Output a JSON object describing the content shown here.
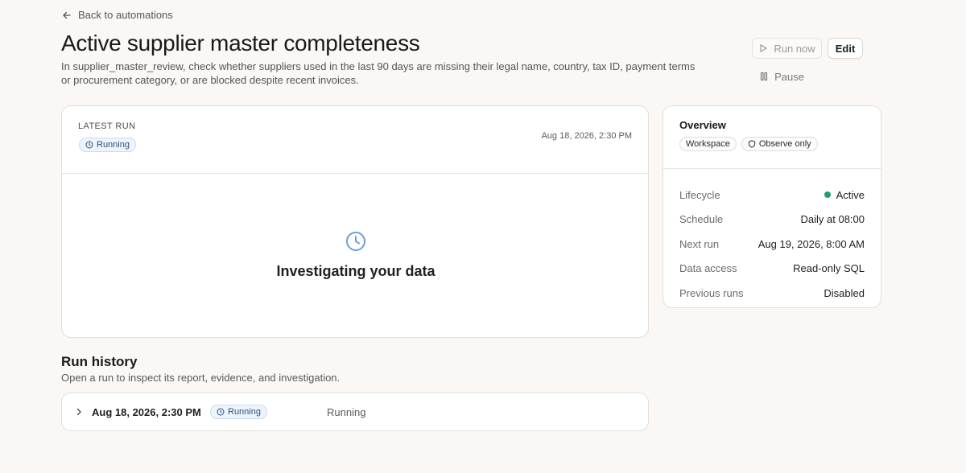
{
  "nav": {
    "back_label": "Back to automations"
  },
  "header": {
    "title": "Active supplier master completeness",
    "description": "In supplier_master_review, check whether suppliers used in the last 90 days are missing their legal name, country, tax ID, payment terms or procurement category, or are blocked despite recent invoices."
  },
  "actions": {
    "run_now_label": "Run now",
    "edit_label": "Edit",
    "pause_label": "Pause"
  },
  "latest_run": {
    "eyebrow": "LATEST RUN",
    "status": "Running",
    "timestamp": "Aug 18, 2026, 2:30 PM",
    "empty_title": "Investigating your data"
  },
  "overview": {
    "title": "Overview",
    "chips": [
      "Workspace",
      "Observe only"
    ],
    "rows": [
      {
        "label": "Lifecycle",
        "value": "Active"
      },
      {
        "label": "Schedule",
        "value": "Daily at 08:00"
      },
      {
        "label": "Next run",
        "value": "Aug 19, 2026, 8:00 AM"
      },
      {
        "label": "Data access",
        "value": "Read-only SQL"
      },
      {
        "label": "Previous runs",
        "value": "Disabled"
      }
    ],
    "lifecycle_color": "#22a06b"
  },
  "run_history": {
    "title": "Run history",
    "subtitle": "Open a run to inspect its report, evidence, and investigation.",
    "rows": [
      {
        "date": "Aug 18, 2026, 2:30 PM",
        "badge": "Running",
        "status": "Running"
      }
    ]
  },
  "colors": {
    "accent_blue": "#2c4f7c",
    "badge_bg": "#eef4fc",
    "clock_blue": "#6a9fd8",
    "page_bg": "#faf7f4"
  }
}
